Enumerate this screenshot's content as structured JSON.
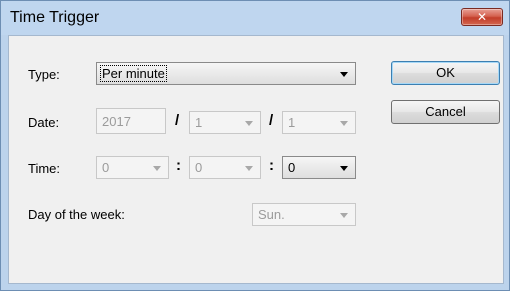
{
  "window": {
    "title": "Time Trigger",
    "close_glyph": "✕"
  },
  "form": {
    "type_label": "Type:",
    "type_value": "Per minute",
    "date_label": "Date:",
    "date_year": "2017",
    "date_sep1": "/",
    "date_month": "1",
    "date_sep2": "/",
    "date_day": "1",
    "time_label": "Time:",
    "time_hour": "0",
    "time_sep1": ":",
    "time_minute": "0",
    "time_sep2": ":",
    "time_second": "0",
    "dow_label": "Day of the week:",
    "dow_value": "Sun."
  },
  "buttons": {
    "ok": "OK",
    "cancel": "Cancel"
  },
  "colors": {
    "title_bar": "#bfd6ef",
    "close_button": "#c94a36",
    "dialog_bg": "#f0f0f0",
    "default_button_border": "#3c7fb1"
  }
}
